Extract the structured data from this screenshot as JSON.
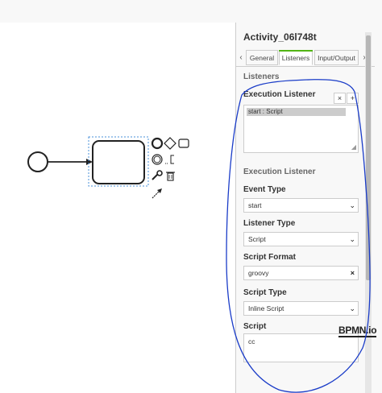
{
  "panel": {
    "title": "Activity_06l748t",
    "tabs": [
      {
        "label": "General",
        "active": false
      },
      {
        "label": "Listeners",
        "active": true
      },
      {
        "label": "Input/Output",
        "active": false
      }
    ],
    "tab_prev_icon": "chevron-left-icon",
    "tab_next_icon": "chevron-right-icon"
  },
  "listeners": {
    "section_title": "Listeners",
    "execution_listener_label": "Execution Listener",
    "remove_label": "×",
    "add_label": "+",
    "items": [
      "start : Script"
    ]
  },
  "detail": {
    "section_title": "Execution Listener",
    "event_type_label": "Event Type",
    "event_type_value": "start",
    "listener_type_label": "Listener Type",
    "listener_type_value": "Script",
    "script_format_label": "Script Format",
    "script_format_value": "groovy",
    "clear_label": "×",
    "script_type_label": "Script Type",
    "script_type_value": "Inline Script",
    "script_label": "Script",
    "script_value": "cc"
  },
  "logo": "BPMN.io",
  "colors": {
    "accent_tab": "#52b415",
    "annotation": "#1a3cc8"
  }
}
